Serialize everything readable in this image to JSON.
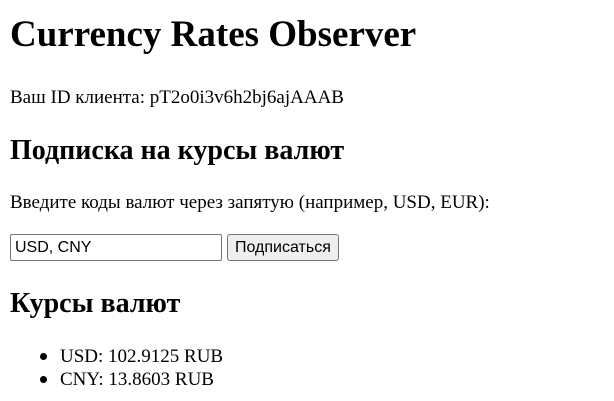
{
  "page": {
    "title": "Currency Rates Observer",
    "client_id_line": "Ваш ID клиента: pT2o0i3v6h2bj6ajAAAB"
  },
  "subscription": {
    "heading": "Подписка на курсы валют",
    "instructions": "Введите коды валют через запятую (например, USD, EUR):",
    "input_value": "USD, CNY",
    "button_label": "Подписаться"
  },
  "rates": {
    "heading": "Курсы валют",
    "items": [
      {
        "text": "USD: 102.9125 RUB"
      },
      {
        "text": "CNY: 13.8603 RUB"
      }
    ]
  }
}
